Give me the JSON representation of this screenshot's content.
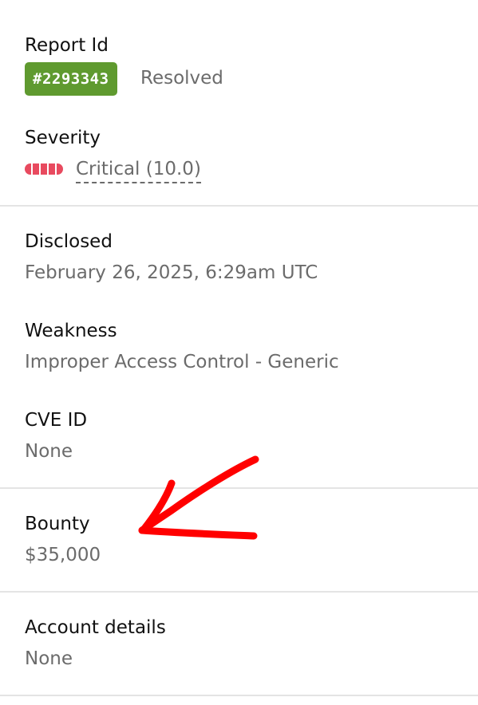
{
  "report": {
    "label": "Report Id",
    "id_badge": "#2293343",
    "status": "Resolved"
  },
  "severity": {
    "label": "Severity",
    "value": "Critical (10.0)",
    "color": "#e84a5f",
    "icon": "severity-meter-icon"
  },
  "disclosed": {
    "label": "Disclosed",
    "value": "February 26, 2025, 6:29am UTC"
  },
  "weakness": {
    "label": "Weakness",
    "value": "Improper Access Control - Generic"
  },
  "cve": {
    "label": "CVE ID",
    "value": "None"
  },
  "bounty": {
    "label": "Bounty",
    "value": "$35,000"
  },
  "account": {
    "label": "Account details",
    "value": "None"
  },
  "annotation": {
    "icon": "red-arrow-icon",
    "color": "#ff0000"
  },
  "colors": {
    "badge_green": "#5f9a2f",
    "label_text": "#111111",
    "value_text": "#6b6b6b",
    "divider": "#e4e4e4"
  }
}
